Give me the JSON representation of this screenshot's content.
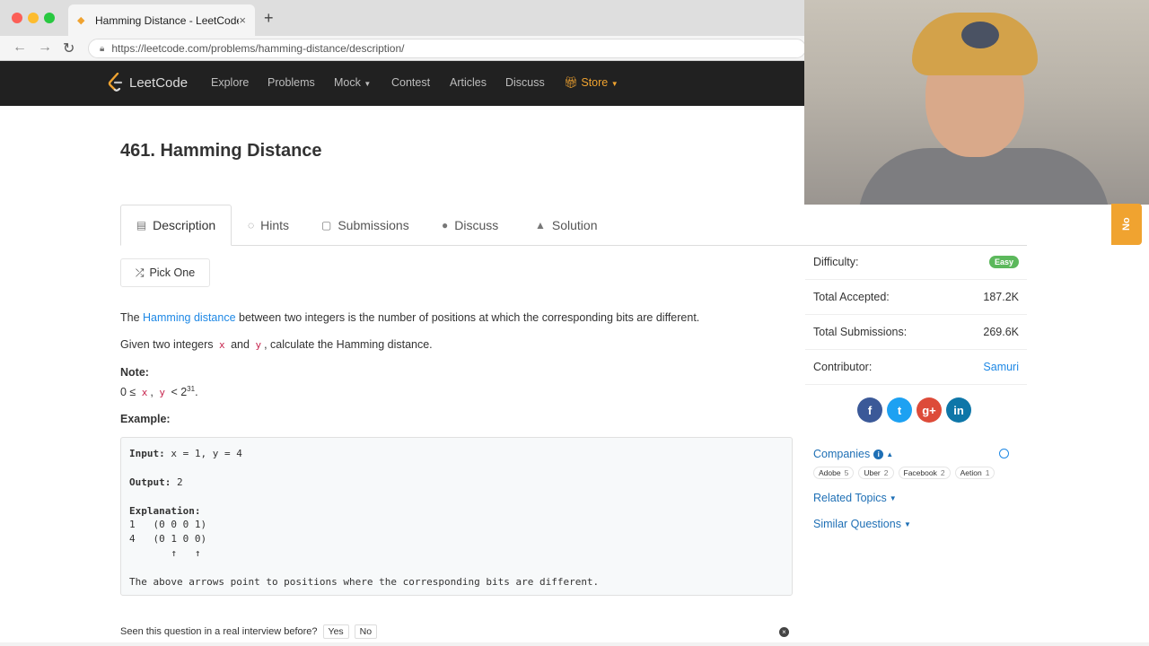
{
  "browser": {
    "tab_title": "Hamming Distance - LeetCode",
    "url": "https://leetcode.com/problems/hamming-distance/description/"
  },
  "nav": {
    "logo": "LeetCode",
    "links": [
      "Explore",
      "Problems",
      "Mock",
      "Contest",
      "Articles",
      "Discuss"
    ],
    "store": "Store"
  },
  "side_note": "No",
  "problem": {
    "title": "461. Hamming Distance",
    "tabs": [
      "Description",
      "Hints",
      "Submissions",
      "Discuss",
      "Solution"
    ],
    "pick_one": "Pick One",
    "p1_prefix": "The ",
    "p1_link": "Hamming distance",
    "p1_suffix": " between two integers is the number of positions at which the corresponding bits are different.",
    "p2_prefix": "Given two integers ",
    "p2_x": "x",
    "p2_and": " and ",
    "p2_y": "y",
    "p2_suffix": ", calculate the Hamming distance.",
    "note_label": "Note:",
    "note_prefix": "0 ≤ ",
    "note_x": "x",
    "note_comma": ", ",
    "note_y": "y",
    "note_lt": " < 2",
    "note_exp": "31",
    "note_end": ".",
    "example_label": "Example:",
    "example": {
      "input_label": "Input:",
      "input_value": " x = 1, y = 4",
      "output_label": "Output:",
      "output_value": " 2",
      "explanation_label": "Explanation:",
      "line1": "1   (0 0 0 1)",
      "line2": "4   (0 1 0 0)",
      "arrows": "       ↑   ↑",
      "footer": "The above arrows point to positions where the corresponding bits are different."
    },
    "seen_question": "Seen this question in a real interview before?",
    "yes": "Yes",
    "no": "No"
  },
  "stats": {
    "difficulty_label": "Difficulty:",
    "difficulty": "Easy",
    "accepted_label": "Total Accepted:",
    "accepted": "187.2K",
    "submissions_label": "Total Submissions:",
    "submissions": "269.6K",
    "contributor_label": "Contributor:",
    "contributor": "Samuri"
  },
  "companies": {
    "label": "Companies",
    "tags": [
      {
        "name": "Adobe",
        "count": "5"
      },
      {
        "name": "Uber",
        "count": "2"
      },
      {
        "name": "Facebook",
        "count": "2"
      },
      {
        "name": "Aetion",
        "count": "1"
      }
    ]
  },
  "related_topics": "Related Topics",
  "similar_questions": "Similar Questions"
}
